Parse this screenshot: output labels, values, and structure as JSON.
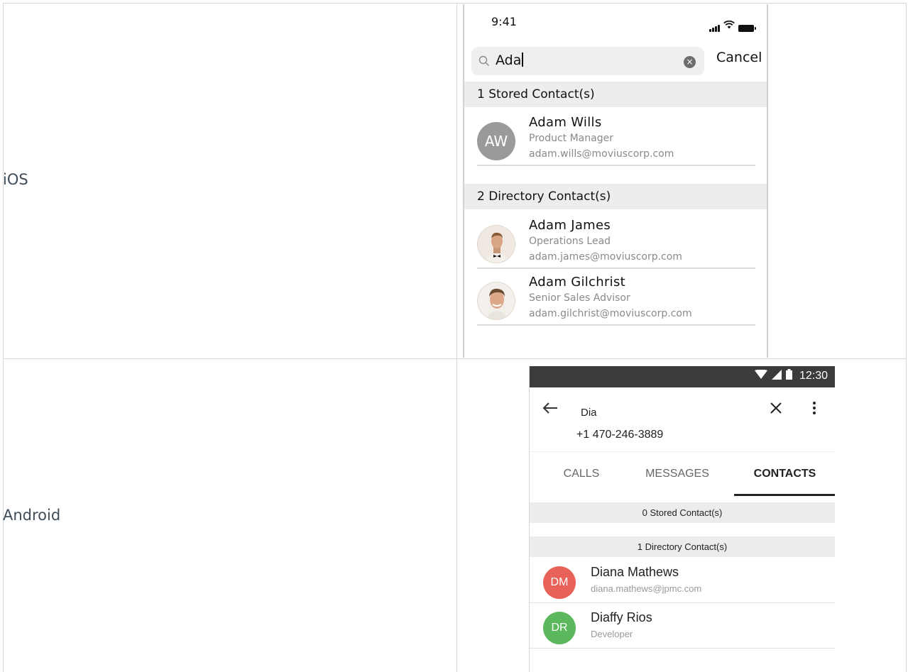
{
  "rows": [
    {
      "label": "iOS"
    },
    {
      "label": "Android"
    }
  ],
  "ios": {
    "status_time": "9:41",
    "search": {
      "value": "Ada"
    },
    "cancel_label": "Cancel",
    "stored_section": "1 Stored Contact(s)",
    "directory_section": "2 Directory Contact(s)",
    "stored_contacts": [
      {
        "initials": "AW",
        "name": "Adam Wills",
        "title": "Product Manager",
        "email": "adam.wills@moviuscorp.com"
      }
    ],
    "directory_contacts": [
      {
        "name": "Adam James",
        "title": "Operations Lead",
        "email": "adam.james@moviuscorp.com"
      },
      {
        "name": "Adam Gilchrist",
        "title": "Senior Sales Advisor",
        "email": "adam.gilchrist@moviuscorp.com"
      }
    ],
    "avatar_color": "#9a9a9a",
    "section_bg": "#ededed"
  },
  "android": {
    "status_time": "12:30",
    "query": "Dia",
    "number": "+1 470-246-3889",
    "tabs": [
      {
        "label": "CALLS",
        "active": false
      },
      {
        "label": "MESSAGES",
        "active": false
      },
      {
        "label": "CONTACTS",
        "active": true
      }
    ],
    "stored_section": "0 Stored Contact(s)",
    "directory_section": "1 Directory Contact(s)",
    "contacts": [
      {
        "initials": "DM",
        "name": "Diana Mathews",
        "sub": "diana.mathews@jpmc.com",
        "color": "#e8625a"
      },
      {
        "initials": "DR",
        "name": "Diaffy Rios",
        "sub": "Developer",
        "color": "#5cb85c"
      }
    ],
    "status_bar_color": "#3b3b3b"
  }
}
